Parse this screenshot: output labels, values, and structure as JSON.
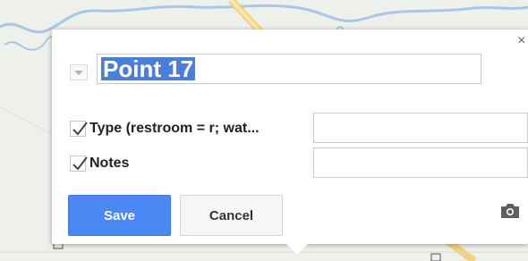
{
  "dialog": {
    "title_value": "Point 17",
    "close_glyph": "×",
    "attributes": [
      {
        "label": "Type (restroom = r; wat...",
        "checked": true,
        "value": ""
      },
      {
        "label": "Notes",
        "checked": true,
        "value": ""
      }
    ],
    "save_label": "Save",
    "cancel_label": "Cancel",
    "icons": {
      "style": "chevron-down-icon",
      "close": "close-icon",
      "check": "checkmark-icon",
      "camera": "camera-icon"
    }
  },
  "colors": {
    "save_button": "#4a89f3",
    "selection_highlight": "#4a7ed9",
    "map_road": "#f5d76e",
    "map_water": "#9fc3e8"
  }
}
